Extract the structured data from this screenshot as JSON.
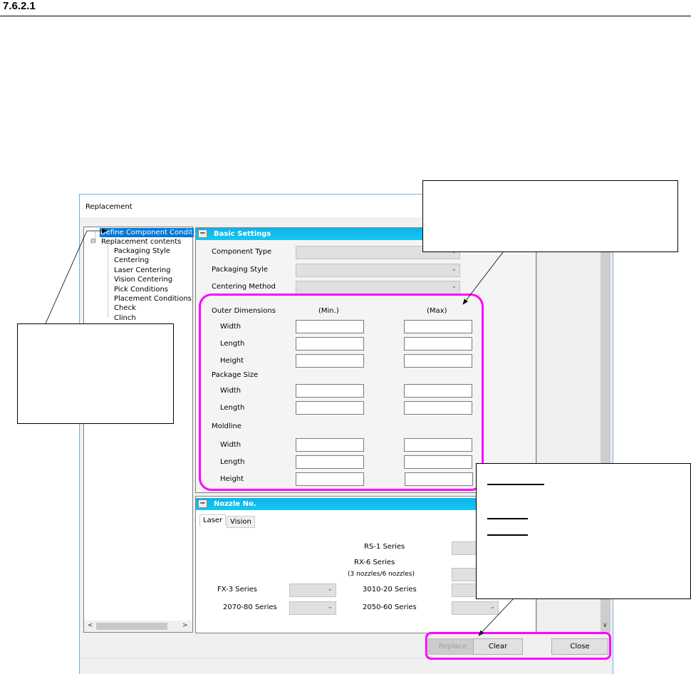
{
  "section_heading": "7.6.2.1",
  "window": {
    "title": "Replacement"
  },
  "tree": {
    "items": [
      "Define Component Condit",
      "Replacement contents",
      "Packaging Style",
      "Centering",
      "Laser Centering",
      "Vision Centering",
      "Pick Conditions",
      "Placement Conditions",
      "Check",
      "Clinch"
    ],
    "expander": "⊟"
  },
  "basic": {
    "header": "Basic Settings",
    "collapse": "−",
    "component_type": "Component Type",
    "packaging_style": "Packaging Style",
    "centering_method": "Centering Method",
    "outer_dimensions": "Outer Dimensions",
    "min": "(Min.)",
    "max": "(Max)",
    "width": "Width",
    "length": "Length",
    "height": "Height",
    "package_size": "Package Size",
    "moldline": "Moldline"
  },
  "nozzle": {
    "header": "Nozzle No.",
    "collapse": "−",
    "tabs": [
      "Laser",
      "Vision"
    ],
    "rs1": "RS-1 Series",
    "rx6": "RX-6 Series",
    "rx6_sub": "(3 nozzles/6 nozzles)",
    "fx3": "FX-3 Series",
    "s3010": "3010-20 Series",
    "s2070": "2070-80 Series",
    "s2050": "2050-60 Series"
  },
  "buttons": {
    "replace": "Replace",
    "clear": "Clear",
    "close": "Close"
  },
  "icons": {
    "chevron": "⌄",
    "left": "<",
    "right": ">",
    "down": "∨"
  },
  "colors": {
    "highlight": "#ff00ff",
    "header": "#14c8f0",
    "selection": "#0078d7"
  }
}
